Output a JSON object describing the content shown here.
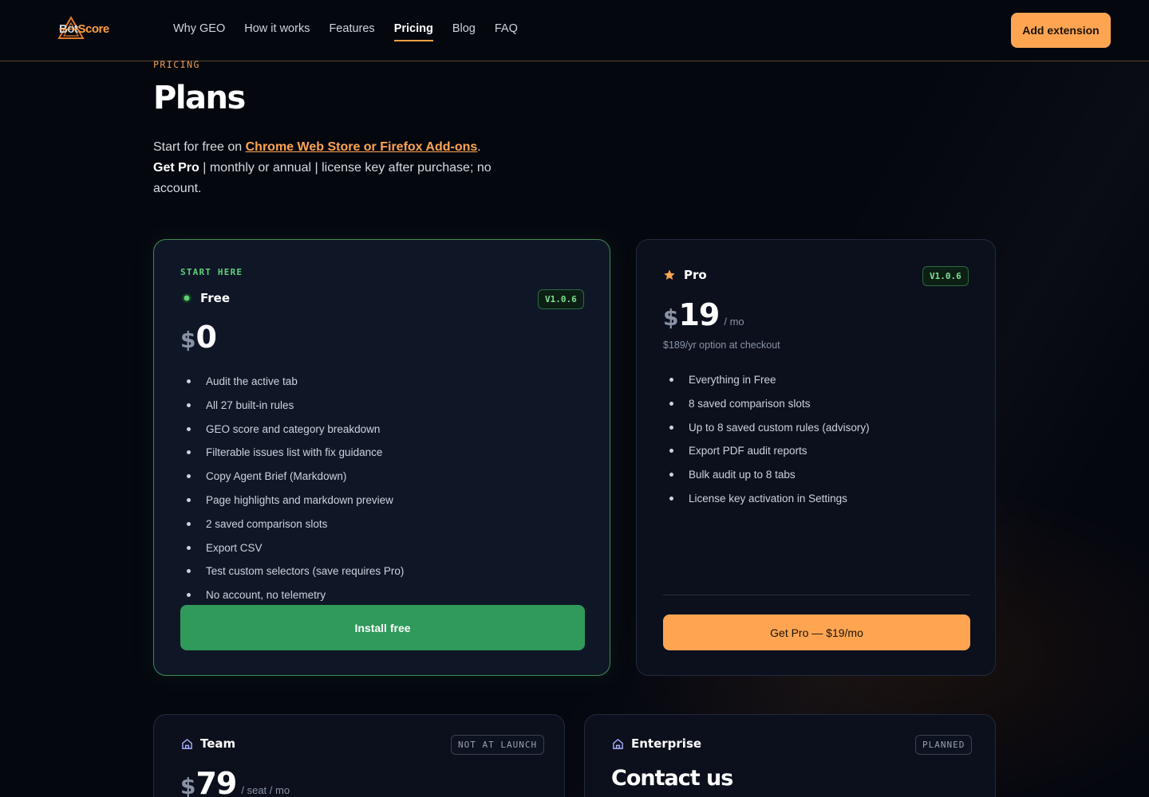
{
  "nav": {
    "logo_bot": "Bot",
    "logo_score": "Score",
    "links": [
      "Why GEO",
      "How it works",
      "Features",
      "Pricing",
      "Blog",
      "FAQ"
    ],
    "cta": "Add extension"
  },
  "hero": {
    "eyebrow": "PRICING",
    "title": "Plans",
    "lede_prefix": "Start for free on ",
    "lede_link": "Chrome Web Store or Firefox Add-ons",
    "lede_mid": ". ",
    "lede_bold": "Get Pro",
    "lede_suffix": " | monthly or annual | license key after purchase; no account."
  },
  "free": {
    "kicker": "START HERE",
    "name": "Free",
    "version": "V1.0.6",
    "currency": "$",
    "amount": "0",
    "features": [
      "Audit the active tab",
      "All 27 built-in rules",
      "GEO score and category breakdown",
      "Filterable issues list with fix guidance",
      "Copy Agent Brief (Markdown)",
      "Page highlights and markdown preview",
      "2 saved comparison slots",
      "Export CSV",
      "Test custom selectors (save requires Pro)",
      "No account, no telemetry"
    ],
    "button": "Install free"
  },
  "pro": {
    "name": "Pro",
    "version": "V1.0.6",
    "currency": "$",
    "amount": "19",
    "per": "/ mo",
    "note": "$189/yr option at checkout",
    "features": [
      "Everything in Free",
      "8 saved comparison slots",
      "Up to 8 saved custom rules (advisory)",
      "Export PDF audit reports",
      "Bulk audit up to 8 tabs",
      "License key activation in Settings"
    ],
    "button": "Get Pro — $19/mo"
  },
  "team": {
    "name": "Team",
    "badge": "NOT AT LAUNCH",
    "currency": "$",
    "amount": "79",
    "per": "/ seat / mo"
  },
  "enterprise": {
    "name": "Enterprise",
    "badge": "PLANNED",
    "contact": "Contact us"
  },
  "colors": {
    "accent": "#ffa552",
    "green": "#2f9a5a",
    "background": "#05070f"
  }
}
